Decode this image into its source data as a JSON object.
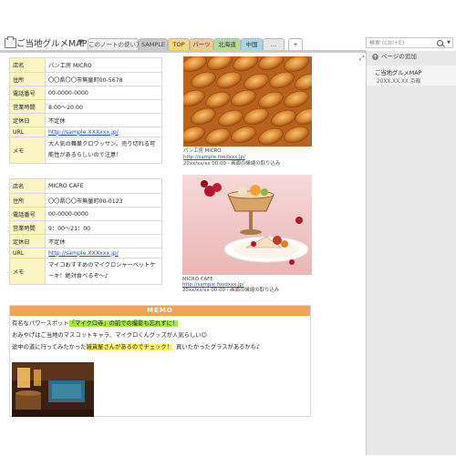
{
  "notebook": {
    "title": "ご当地グルメMAP"
  },
  "tabs": [
    {
      "label": "このノートの使い方"
    },
    {
      "label": "SAMPLE"
    },
    {
      "label": "TOP"
    },
    {
      "label": "パーツ"
    },
    {
      "label": "北海道"
    },
    {
      "label": "中国"
    },
    {
      "label": "…"
    },
    {
      "label": "+"
    }
  ],
  "search": {
    "placeholder": "検索 (Ctrl+E)"
  },
  "right_panel": {
    "add_page": "ページの追加",
    "page_title": "ご当地グルメMAP",
    "page_date": "20XX.XX.XX 京都"
  },
  "shop1": {
    "rows": [
      {
        "label": "店名",
        "value": "パン工房 MICRO"
      },
      {
        "label": "住所",
        "value": "〇〇県〇〇市無量町00-5678"
      },
      {
        "label": "電話番号",
        "value": "00-0000-0000"
      },
      {
        "label": "営業時間",
        "value": "8:00〜20:00"
      },
      {
        "label": "定休日",
        "value": "不定休"
      },
      {
        "label": "URL",
        "value": "http://sample.XXXxxx.jp/"
      },
      {
        "label": "メモ",
        "value": "大人気の舞巣クロワッサン。売り切れる可能性があるらしいので注意！"
      }
    ],
    "caption_name": "パン工房 MICRO",
    "caption_url": "http://sample.foodxxx.jp/",
    "caption_date": "20xx/xx/xx 00:00 - 画面の縁縮の取り込み"
  },
  "shop2": {
    "rows": [
      {
        "label": "店名",
        "value": "MICRO CAFE"
      },
      {
        "label": "住所",
        "value": "〇〇県〇〇市無量町00-0123"
      },
      {
        "label": "電話番号",
        "value": "00-0000-0000"
      },
      {
        "label": "営業時間",
        "value": "9：00〜21：00"
      },
      {
        "label": "定休日",
        "value": "不定休"
      },
      {
        "label": "URL",
        "value": "http://sample.XXXxxx.jp/"
      },
      {
        "label": "メモ",
        "value": "マイコおすすめのマイクロシャーベットケーキ！絶対食べるぞ〜♪"
      }
    ],
    "caption_name": "MICRO CAFE",
    "caption_url": "http://sample.foodxxx.jp/",
    "caption_date": "20xx/xx/xx 00:00 - 画面の縁縮の取り込み"
  },
  "memo": {
    "header": "MEMO",
    "line1_a": "有名なパワースポット",
    "line1_b": "「マイクロ寺」の前での撮影も忘れずに！",
    "line2": "おみやげはご当地のマスコットキャラ、マイクロくんグッズが人気らしい☺",
    "line3_a": "途中の道に行ってみたかった",
    "line3_b": "雑貨屋さんがあるのでチェック！",
    "line3_c": "買いたかったグラスがあるかも♪"
  },
  "colors": {
    "memo_header": "#f2a35a",
    "label_cell": "#fbf5c3",
    "highlight_green": "#a8e64a",
    "highlight_yellow": "#fff36a",
    "link": "#1e4fb5"
  }
}
